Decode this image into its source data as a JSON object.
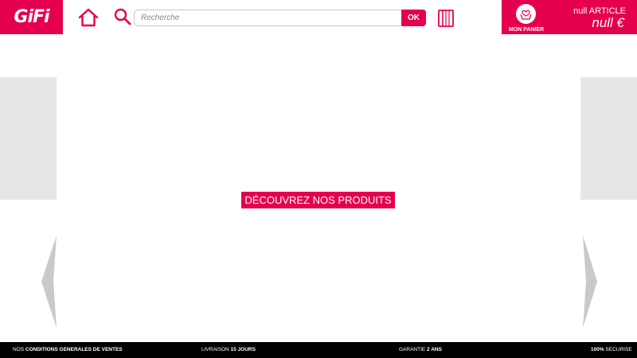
{
  "header": {
    "logo_text": "GiFi",
    "search": {
      "placeholder": "Recherche",
      "value": ""
    },
    "ok_label": "OK",
    "cart": {
      "label": "MON PANIER",
      "count_text": "null ARTICLE",
      "total_text": "null €"
    }
  },
  "main": {
    "cta_label": "DÉCOUVREZ NOS PRODUITS"
  },
  "footer": {
    "items": [
      {
        "prefix": "NOS ",
        "bold": "CONDITIONS GENERALES DE VENTES",
        "suffix": ""
      },
      {
        "prefix": "LIVRAISON ",
        "bold": "15 JOURS",
        "suffix": ""
      },
      {
        "prefix": "GARANTIE ",
        "bold": "2 ANS",
        "suffix": ""
      },
      {
        "prefix": "",
        "bold": "100%",
        "suffix": " SECURISE"
      }
    ]
  },
  "colors": {
    "brand": "#e5004f",
    "panel_gray": "#e6e6e6",
    "arrow_gray": "#c9c9c9",
    "footer_bg": "#000000"
  },
  "icons": [
    "home-icon",
    "search-icon",
    "catalog-icon",
    "cart-icon",
    "chevron-left-icon",
    "chevron-right-icon"
  ]
}
